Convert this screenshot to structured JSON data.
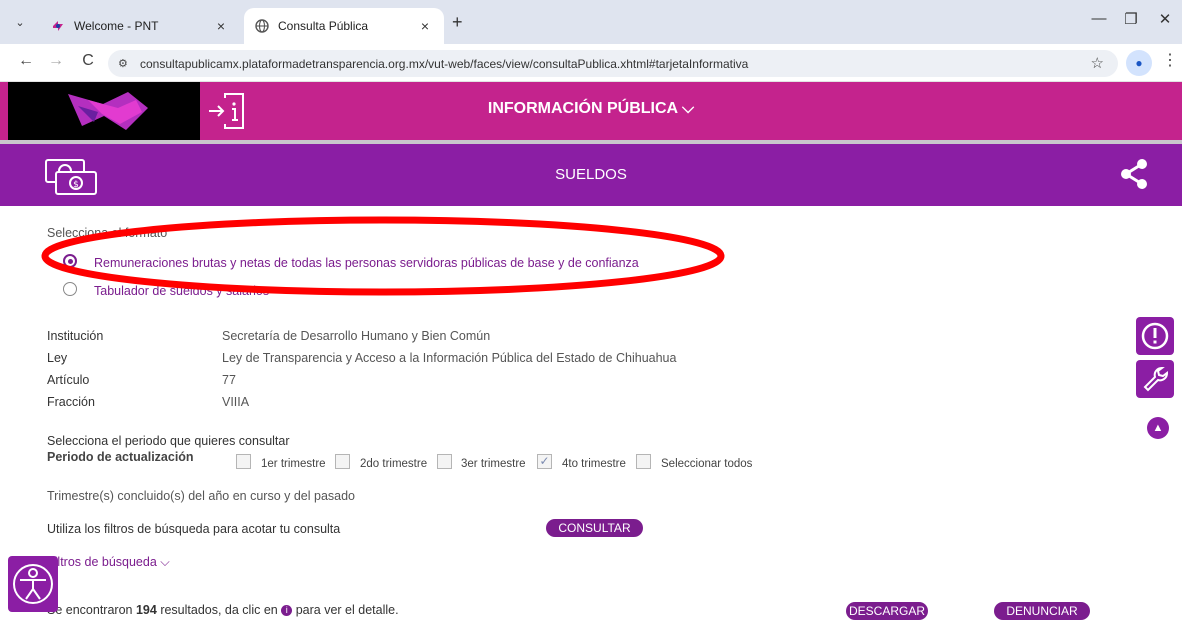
{
  "browser": {
    "tabs": [
      {
        "title": "Welcome - PNT",
        "active": false
      },
      {
        "title": "Consulta Pública",
        "active": true
      }
    ],
    "url": "consultapublicamx.plataformadetransparencia.org.mx/vut-web/faces/view/consultaPublica.xhtml#tarjetaInformativa",
    "close_glyph": "×",
    "newtab_glyph": "+",
    "back_glyph": "←",
    "forward_glyph": "→",
    "reload_glyph": "C",
    "minimize_glyph": "—",
    "restore_glyph": "❐",
    "winclose_glyph": "✕",
    "star_glyph": "☆",
    "kebab_glyph": "⋮",
    "tabs_dropdown_glyph": "⌄"
  },
  "site": {
    "nav_title": "INFORMACIÓN PÚBLICA ⌵",
    "section_title": "SUELDOS",
    "accent": "#8b1ea4",
    "header_color": "#c4238d"
  },
  "format": {
    "label": "Selecciona el formato",
    "options": [
      {
        "label": "Remuneraciones brutas y netas de todas las personas servidoras públicas de base y de confianza",
        "selected": true
      },
      {
        "label": "Tabulador de sueldos y salarios",
        "selected": false
      }
    ]
  },
  "details": [
    {
      "key": "Institución",
      "value": "Secretaría de Desarrollo Humano y Bien Común"
    },
    {
      "key": "Ley",
      "value": "Ley de Transparencia y Acceso a la Información Pública del Estado de Chihuahua"
    },
    {
      "key": "Artículo",
      "value": "77"
    },
    {
      "key": "Fracción",
      "value": "VIIIA"
    }
  ],
  "period": {
    "prompt": "Selecciona el periodo que quieres consultar",
    "label": "Periodo de actualización",
    "options": [
      {
        "label": "1er trimestre",
        "checked": false
      },
      {
        "label": "2do trimestre",
        "checked": false
      },
      {
        "label": "3er trimestre",
        "checked": false
      },
      {
        "label": "4to trimestre",
        "checked": true
      },
      {
        "label": "Seleccionar todos",
        "checked": false
      }
    ],
    "note": "Trimestre(s) concluido(s) del año en curso y del pasado"
  },
  "filters": {
    "hint": "Utiliza los filtros de búsqueda para acotar tu consulta",
    "consult_button": "CONSULTAR",
    "toggle": "Filtros de búsqueda ⌵"
  },
  "results": {
    "prefix": "Se encontraron",
    "count": "194",
    "suffix": "resultados, da clic en",
    "tail": "para ver el detalle.",
    "download_button": "DESCARGAR",
    "report_button": "DENUNCIAR"
  },
  "annotation_color": "#ff0000"
}
